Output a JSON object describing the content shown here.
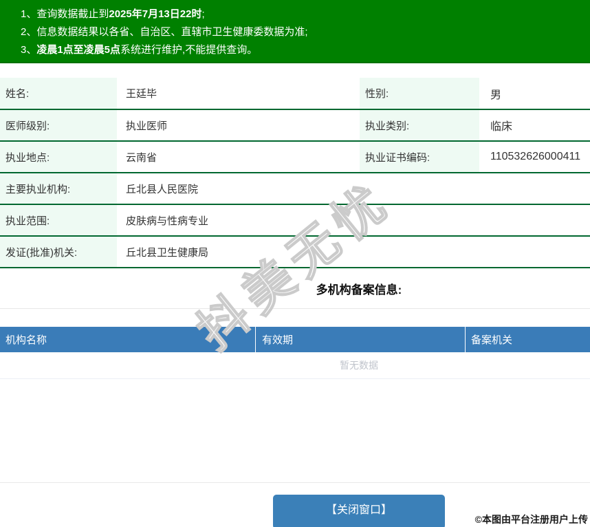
{
  "notice": {
    "line1": {
      "num": "1、",
      "pre": "查询数据截止到",
      "bold": "2025年7月13日22时",
      "post": ";"
    },
    "line2": {
      "num": "2、",
      "pre": "信息数据结果以各省、自治区、直辖市卫生健康委数据为准;",
      "bold": "",
      "post": ""
    },
    "line3": {
      "num": "3、",
      "pre": "",
      "bold": "凌晨1点至凌晨5点",
      "post": "系统进行维护,不能提供查询。"
    }
  },
  "profile": {
    "rows": [
      {
        "label1": "姓名:",
        "value1": "王廷毕",
        "label2": "性别:",
        "value2": "男"
      },
      {
        "label1": "医师级别:",
        "value1": "执业医师",
        "label2": "执业类别:",
        "value2": "临床"
      },
      {
        "label1": "执业地点:",
        "value1": "云南省",
        "label2": "执业证书编码:",
        "value2": "110532626000411"
      },
      {
        "label1": "主要执业机构:",
        "value1": "丘北县人民医院"
      },
      {
        "label1": "执业范围:",
        "value1": "皮肤病与性病专业"
      },
      {
        "label1": "发证(批准)机关:",
        "value1": "丘北县卫生健康局"
      }
    ]
  },
  "filing": {
    "title": "多机构备案信息:",
    "headers": [
      "机构名称",
      "有效期",
      "备案机关"
    ],
    "empty_text": "暂无数据"
  },
  "watermark_text": "抖美无忧",
  "footer": {
    "close_button": "【关闭窗口】",
    "copyright": "©本图由平台注册用户上传"
  },
  "colors": {
    "banner_green": "#008000",
    "table_border_green": "#00672f",
    "label_bg_mint": "#eefaf3",
    "header_blue": "#3a7cb8",
    "button_blue": "#3b80b8",
    "empty_text_gray": "#c0c4cc"
  }
}
